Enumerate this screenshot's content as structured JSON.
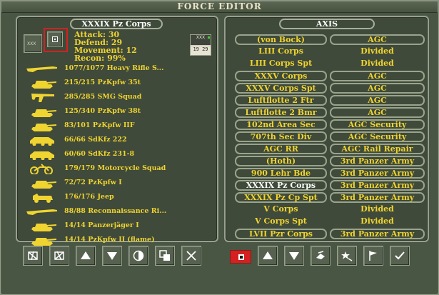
{
  "window": {
    "title": "FORCE EDITOR"
  },
  "left_panel": {
    "header": "XXXIX Pz Corps",
    "unit_type_label": "XXX",
    "stats": {
      "attack": "Attack: 30",
      "defend": "Defend: 29",
      "movement": "Movement: 12",
      "recon": "Recon: 99%"
    },
    "corps_icon": {
      "top": "XXX",
      "bottom": "19 29"
    },
    "units": [
      {
        "icon": "rifle-icon",
        "label": "1077/1077 Heavy Rifle S..."
      },
      {
        "icon": "tank-icon",
        "label": "215/215 PzKpfw 35t"
      },
      {
        "icon": "smg-icon",
        "label": "285/285 SMG Squad"
      },
      {
        "icon": "tank-icon",
        "label": "125/340 PzKpfw 38t"
      },
      {
        "icon": "tank-icon",
        "label": "83/101 PzKpfw IIF"
      },
      {
        "icon": "armored-car-icon",
        "label": "66/66 SdKfz 222"
      },
      {
        "icon": "armored-car-icon",
        "label": "60/60 SdKfz 231-8"
      },
      {
        "icon": "motorcycle-icon",
        "label": "179/179 Motorcycle Squad"
      },
      {
        "icon": "tank-icon",
        "label": "72/72 PzKpfw I"
      },
      {
        "icon": "jeep-icon",
        "label": "176/176 Jeep"
      },
      {
        "icon": "rifle-icon",
        "label": "88/88 Reconnaissance Ri..."
      },
      {
        "icon": "tank-icon",
        "label": "14/14 Panzerjäger I"
      },
      {
        "icon": "tank-icon",
        "label": "14/14 PzKpfw II (flame)"
      }
    ]
  },
  "right_panel": {
    "header": "AXIS",
    "formations": [
      {
        "name": "(von Bock)",
        "parent": "AGC",
        "name_border": true,
        "parent_border": true
      },
      {
        "name": "LIII Corps",
        "parent": "Divided",
        "name_border": false,
        "parent_border": false
      },
      {
        "name": "LIII Corps Spt",
        "parent": "Divided",
        "name_border": false,
        "parent_border": false
      },
      {
        "name": "XXXV Corps",
        "parent": "AGC",
        "name_border": true,
        "parent_border": true
      },
      {
        "name": "XXXV Corps Spt",
        "parent": "AGC",
        "name_border": true,
        "parent_border": true
      },
      {
        "name": "Luftflotte 2 Ftr",
        "parent": "AGC",
        "name_border": true,
        "parent_border": true
      },
      {
        "name": "Luftflotte 2 Bmr",
        "parent": "AGC",
        "name_border": true,
        "parent_border": true
      },
      {
        "name": "102nd Area Sec",
        "parent": "AGC Security",
        "name_border": true,
        "parent_border": true
      },
      {
        "name": "707th Sec Div",
        "parent": "AGC Security",
        "name_border": true,
        "parent_border": true
      },
      {
        "name": "AGC RR",
        "parent": "AGC Rail Repair",
        "name_border": true,
        "parent_border": true
      },
      {
        "name": "(Hoth)",
        "parent": "3rd Panzer Army",
        "name_border": true,
        "parent_border": true
      },
      {
        "name": "900 Lehr Bde",
        "parent": "3rd Panzer Army",
        "name_border": true,
        "parent_border": true
      },
      {
        "name": "XXXIX Pz Corps",
        "parent": "3rd Panzer Army",
        "name_border": true,
        "parent_border": true,
        "selected": true
      },
      {
        "name": "XXXIX Pz Cp Spt",
        "parent": "3rd Panzer Army",
        "name_border": true,
        "parent_border": true
      },
      {
        "name": "V Corps",
        "parent": "Divided",
        "name_border": false,
        "parent_border": false
      },
      {
        "name": "V Corps Spt",
        "parent": "Divided",
        "name_border": false,
        "parent_border": false
      },
      {
        "name": "LVII Pzr Corps",
        "parent": "3rd Panzer Army",
        "name_border": true,
        "parent_border": true
      }
    ]
  },
  "colors": {
    "text_yellow": "#f0d430",
    "selected_white": "#ffffff",
    "highlight_red": "#d42020"
  },
  "left_buttons": [
    "split-unit-icon",
    "merge-unit-icon",
    "move-up-icon",
    "move-down-icon",
    "half-circle-icon",
    "copy-icon",
    "close-icon"
  ],
  "right_buttons": [
    "axis-flag-icon",
    "move-up-icon",
    "move-down-icon",
    "disband-icon",
    "star-icon",
    "flag-icon",
    "check-icon"
  ]
}
